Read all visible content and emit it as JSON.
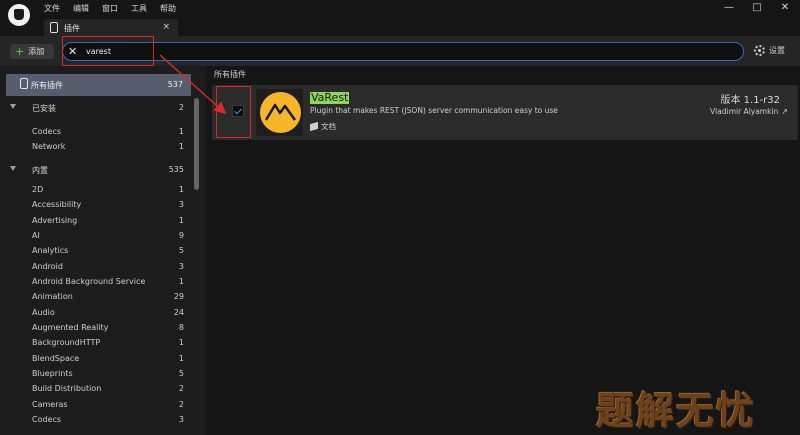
{
  "menu": {
    "items": [
      "文件",
      "编辑",
      "窗口",
      "工具",
      "帮助"
    ]
  },
  "window_controls": {
    "minimize": "—",
    "maximize": "□",
    "close": "✕"
  },
  "tab": {
    "label": "插件",
    "close": "×"
  },
  "toolbar": {
    "add_label": "添加",
    "add_plus": "+",
    "search_value": "varest",
    "search_clear": "✕",
    "settings_label": "设置"
  },
  "sidebar": {
    "all": {
      "label": "所有插件",
      "count": "537"
    },
    "rows": [
      {
        "label": "已安装",
        "count": "2",
        "section": true
      },
      {
        "label": "Codecs",
        "count": "1"
      },
      {
        "label": "Network",
        "count": "1"
      },
      {
        "label": "内置",
        "count": "535",
        "section": true
      },
      {
        "label": "2D",
        "count": "1"
      },
      {
        "label": "Accessibility",
        "count": "3"
      },
      {
        "label": "Advertising",
        "count": "1"
      },
      {
        "label": "AI",
        "count": "9"
      },
      {
        "label": "Analytics",
        "count": "5"
      },
      {
        "label": "Android",
        "count": "3"
      },
      {
        "label": "Android Background Service",
        "count": "1"
      },
      {
        "label": "Animation",
        "count": "29"
      },
      {
        "label": "Audio",
        "count": "24"
      },
      {
        "label": "Augmented Reality",
        "count": "8"
      },
      {
        "label": "BackgroundHTTP",
        "count": "1"
      },
      {
        "label": "BlendSpace",
        "count": "1"
      },
      {
        "label": "Blueprints",
        "count": "5"
      },
      {
        "label": "Build Distribution",
        "count": "2"
      },
      {
        "label": "Cameras",
        "count": "2"
      },
      {
        "label": "Codecs",
        "count": "3"
      }
    ]
  },
  "main": {
    "header": "所有插件",
    "plugin": {
      "name": "VaRest",
      "description": "Plugin that makes REST (JSON) server communication easy to use",
      "docs_label": "文档",
      "version": "版本 1.1-r32",
      "author": "Vladimir Alyamkin",
      "enabled": true
    }
  },
  "watermark": "题解无忧",
  "colors": {
    "accent": "#3a68b8",
    "annotation": "#d42a2a",
    "highlight": "#8fd45e",
    "logo": "#f7b52a"
  }
}
